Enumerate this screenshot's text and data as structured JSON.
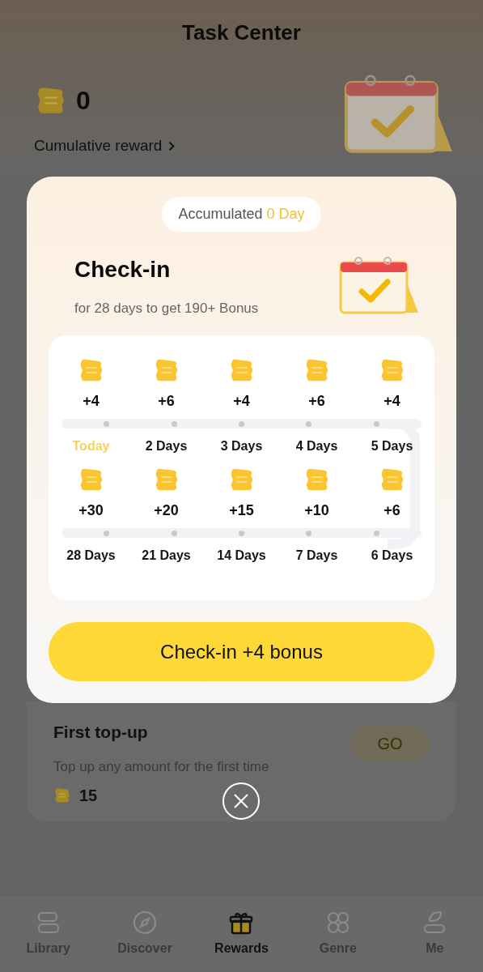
{
  "header": {
    "title": "Task Center"
  },
  "balance": {
    "amount": "0",
    "link": "Cumulative reward"
  },
  "modal": {
    "badge_prefix": "Accumulated",
    "badge_value": "0 Day",
    "title": "Check-in",
    "subtitle": "for 28 days to get 190+ Bonus",
    "rows": [
      [
        {
          "amount": "+4",
          "label": "Today",
          "current": true
        },
        {
          "amount": "+6",
          "label": "2 Days",
          "current": false
        },
        {
          "amount": "+4",
          "label": "3 Days",
          "current": false
        },
        {
          "amount": "+6",
          "label": "4 Days",
          "current": false
        },
        {
          "amount": "+4",
          "label": "5 Days",
          "current": false
        }
      ],
      [
        {
          "amount": "+30",
          "label": "28 Days",
          "current": false
        },
        {
          "amount": "+20",
          "label": "21 Days",
          "current": false
        },
        {
          "amount": "+15",
          "label": "14 Days",
          "current": false
        },
        {
          "amount": "+10",
          "label": "7 Days",
          "current": false
        },
        {
          "amount": "+6",
          "label": "6 Days",
          "current": false
        }
      ]
    ],
    "button": "Check-in +4 bonus"
  },
  "task": {
    "title": "First top-up",
    "description": "Top up any amount for the first time",
    "reward": "15",
    "button": "GO"
  },
  "nav": [
    {
      "label": "Library",
      "kind": "library",
      "selected": false
    },
    {
      "label": "Discover",
      "kind": "discover",
      "selected": false
    },
    {
      "label": "Rewards",
      "kind": "rewards",
      "selected": true
    },
    {
      "label": "Genre",
      "kind": "genre",
      "selected": false
    },
    {
      "label": "Me",
      "kind": "me",
      "selected": false
    }
  ]
}
